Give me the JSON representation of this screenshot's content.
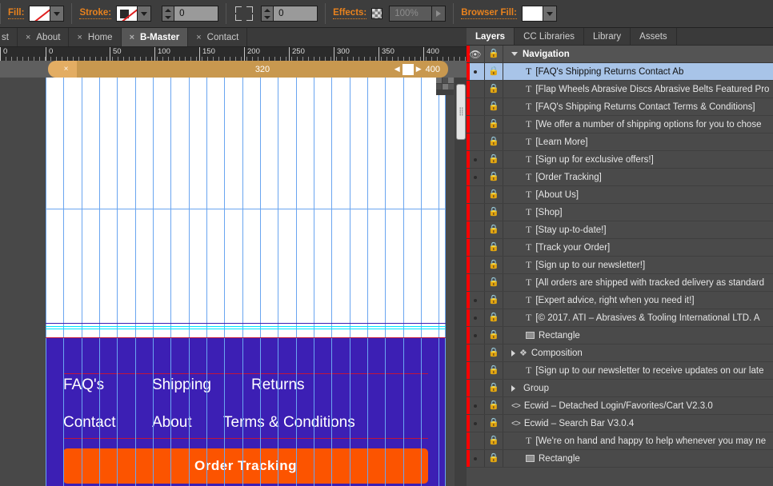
{
  "control_bar": {
    "fill": {
      "label": "Fill:",
      "swatch": "none",
      "dropdown_icon": "chevron-down-icon"
    },
    "stroke": {
      "label": "Stroke:",
      "swatch": "none",
      "dropdown_icon": "chevron-down-icon"
    },
    "stroke_weight": {
      "value": "0"
    },
    "corner_icon": "corner-radius-icon",
    "corner_radius": {
      "value": "0"
    },
    "effects": {
      "label": "Effects:",
      "swatch_icon": "transparency-checker-icon",
      "opacity_value": "100%",
      "play_icon": "play-triangle-icon"
    },
    "browser_fill": {
      "label": "Browser Fill:",
      "swatch_color": "#ffffff",
      "dropdown_icon": "chevron-down-icon"
    }
  },
  "tabs": [
    {
      "label": "st",
      "close_icon": "x",
      "active": false
    },
    {
      "label": "About",
      "close_icon": "×",
      "active": false
    },
    {
      "label": "Home",
      "close_icon": "×",
      "active": false
    },
    {
      "label": "B-Master",
      "close_icon": "×",
      "active": true
    },
    {
      "label": "Contact",
      "close_icon": "×",
      "active": false
    }
  ],
  "ruler": {
    "labels": [
      "0",
      "0",
      "50",
      "100",
      "150",
      "200",
      "250",
      "300",
      "350",
      "400"
    ]
  },
  "breakpoint_bar": {
    "close_icon": "×",
    "width_label": "320",
    "handle_value": "400",
    "left_arrow": "◀",
    "right_arrow": "▶"
  },
  "canvas": {
    "footer": {
      "links_row1": [
        "FAQ's",
        "Shipping",
        "Returns"
      ],
      "links_row2": [
        "Contact",
        "About",
        "Terms & Conditions"
      ],
      "button_label": "Order Tracking",
      "background_color": "#3c1fb4",
      "button_color": "#fc5400",
      "link_color": "#ffffff"
    },
    "guide_color": "#6aa5f0"
  },
  "panel": {
    "tabs": [
      {
        "label": "Layers",
        "active": true
      },
      {
        "label": "CC Libraries",
        "active": false
      },
      {
        "label": "Library",
        "active": false
      },
      {
        "label": "Assets",
        "active": false
      }
    ],
    "layer_group": {
      "name": "Navigation",
      "eye_icon": "eye-icon",
      "lock_icon": "lock-icon",
      "disclosure_icon": "triangle-down-icon"
    },
    "items": [
      {
        "name": "[FAQ's              Shipping             Returns  Contact          Ab",
        "glyph": "text",
        "selected": true,
        "visible": true,
        "locked": true,
        "indent": 0
      },
      {
        "name": "[Flap Wheels Abrasive Discs Abrasive Belts Featured Pro",
        "glyph": "text",
        "selected": false,
        "visible": false,
        "locked": true,
        "indent": 0
      },
      {
        "name": "[FAQ's Shipping  Returns Contact Terms & Conditions]",
        "glyph": "text",
        "selected": false,
        "visible": false,
        "locked": true,
        "indent": 0
      },
      {
        "name": "[We offer a number of shipping options for you to chose",
        "glyph": "text",
        "selected": false,
        "visible": false,
        "locked": true,
        "indent": 0
      },
      {
        "name": "[Learn More]",
        "glyph": "text",
        "selected": false,
        "visible": false,
        "locked": true,
        "indent": 0
      },
      {
        "name": "[Sign up for exclusive offers!]",
        "glyph": "text",
        "selected": false,
        "visible": true,
        "locked": true,
        "indent": 0
      },
      {
        "name": "[Order Tracking]",
        "glyph": "text",
        "selected": false,
        "visible": true,
        "locked": true,
        "indent": 0
      },
      {
        "name": "[About Us]",
        "glyph": "text",
        "selected": false,
        "visible": false,
        "locked": true,
        "indent": 0
      },
      {
        "name": "[Shop]",
        "glyph": "text",
        "selected": false,
        "visible": false,
        "locked": true,
        "indent": 0
      },
      {
        "name": "[Stay up-to-date!]",
        "glyph": "text",
        "selected": false,
        "visible": false,
        "locked": true,
        "indent": 0
      },
      {
        "name": "[Track your Order]",
        "glyph": "text",
        "selected": false,
        "visible": false,
        "locked": true,
        "indent": 0
      },
      {
        "name": "[Sign up to our newsletter!]",
        "glyph": "text",
        "selected": false,
        "visible": false,
        "locked": true,
        "indent": 0
      },
      {
        "name": "[All orders are shipped with tracked delivery as standard",
        "glyph": "text",
        "selected": false,
        "visible": false,
        "locked": true,
        "indent": 0
      },
      {
        "name": "[Expert advice, right when you need it!]",
        "glyph": "text",
        "selected": false,
        "visible": true,
        "locked": true,
        "indent": 0
      },
      {
        "name": "[© 2017. ATI – Abrasives & Tooling International LTD. A",
        "glyph": "text",
        "selected": false,
        "visible": true,
        "locked": true,
        "indent": 0
      },
      {
        "name": "Rectangle",
        "glyph": "rect",
        "selected": false,
        "visible": true,
        "locked": true,
        "indent": 0
      },
      {
        "name": "Composition",
        "glyph": "composition",
        "selected": false,
        "visible": false,
        "locked": true,
        "indent": 1,
        "disclosure": "triangle-right-icon"
      },
      {
        "name": "[Sign up to our newsletter to receive updates on our late",
        "glyph": "text",
        "selected": false,
        "visible": false,
        "locked": true,
        "indent": 0
      },
      {
        "name": "Group",
        "glyph": "group",
        "selected": false,
        "visible": false,
        "locked": true,
        "indent": 1,
        "disclosure": "triangle-right-icon"
      },
      {
        "name": "Ecwid – Detached Login/Favorites/Cart V2.3.0",
        "glyph": "code",
        "selected": false,
        "visible": true,
        "locked": true,
        "indent": 1
      },
      {
        "name": "Ecwid – Search Bar V3.0.4",
        "glyph": "code",
        "selected": false,
        "visible": true,
        "locked": true,
        "indent": 1
      },
      {
        "name": "[We're on hand and happy to help whenever you may ne",
        "glyph": "text",
        "selected": false,
        "visible": false,
        "locked": true,
        "indent": 0
      },
      {
        "name": "Rectangle",
        "glyph": "rect",
        "selected": false,
        "visible": true,
        "locked": true,
        "indent": 0
      }
    ]
  }
}
